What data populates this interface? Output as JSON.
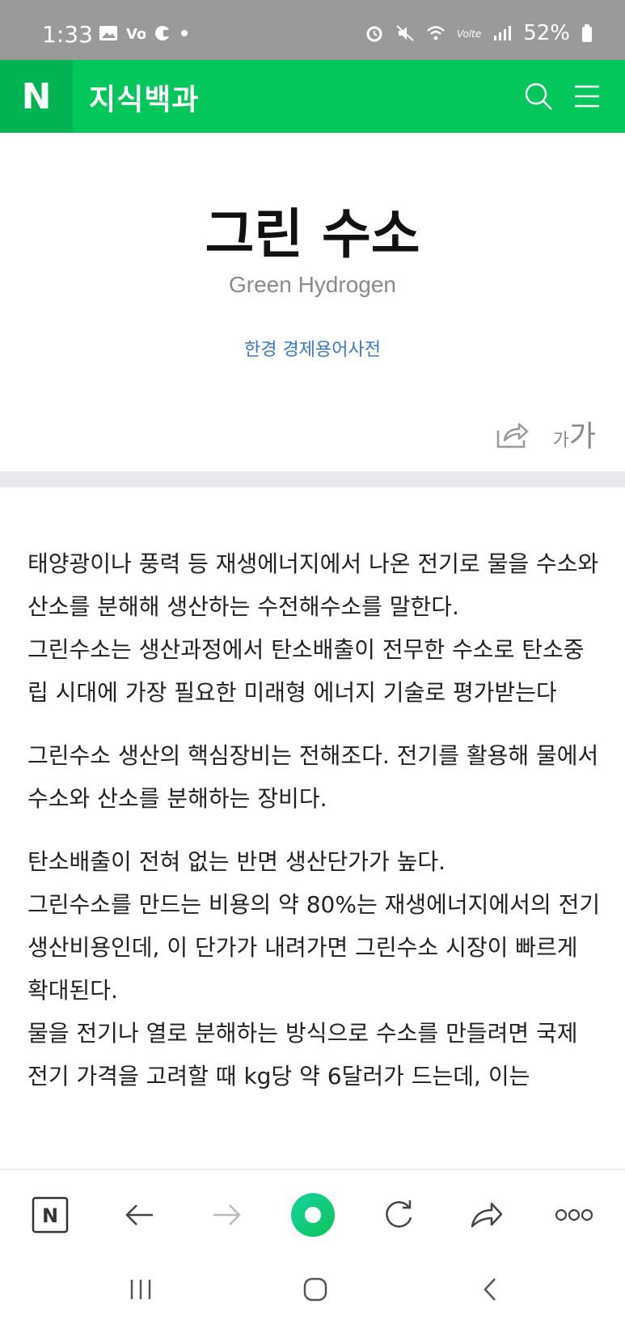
{
  "status_bar": {
    "time": "1:33",
    "battery": "52%",
    "icons": [
      "image-icon",
      "volte-icon",
      "data-icon",
      "dot-icon",
      "alarm-icon",
      "mute-icon",
      "wifi-icon",
      "lte-icon",
      "signal-icon",
      "battery-icon"
    ]
  },
  "header": {
    "logo": "N",
    "title": "지식백과",
    "icons": [
      "search-icon",
      "menu-icon"
    ],
    "color": "#03c75a"
  },
  "article": {
    "title": "그린 수소",
    "subtitle": "Green Hydrogen",
    "source": "한경 경제용어사전",
    "font_small": "가",
    "font_large": "가",
    "paragraphs": [
      "태양광이나 풍력 등 재생에너지에서 나온 전기로 물을 수소와 산소를 분해해 생산하는 수전해수소를 말한다.\n그린수소는 생산과정에서 탄소배출이 전무한 수소로 탄소중립 시대에 가장 필요한 미래형 에너지 기술로 평가받는다",
      "그린수소 생산의 핵심장비는 전해조다. 전기를 활용해 물에서 수소와 산소를 분해하는 장비다.",
      "탄소배출이 전혀 없는 반면 생산단가가 높다.\n그린수소를 만드는 비용의 약 80%는 재생에너지에서의 전기 생산비용인데, 이 단가가 내려가면 그린수소 시장이 빠르게 확대된다.\n물을 전기나 열로 분해하는 방식으로 수소를 만들려면 국제 전기 가격을 고려할 때 kg당 약 6달러가 드는데, 이는"
    ]
  },
  "toolbar": {
    "home_label": "N",
    "icons": [
      "naver-home-icon",
      "back-arrow-icon",
      "forward-arrow-icon",
      "green-dot-icon",
      "reload-icon",
      "share-icon",
      "more-icon"
    ]
  },
  "navbar": {
    "icons": [
      "recent-apps-icon",
      "home-icon",
      "back-icon"
    ]
  }
}
